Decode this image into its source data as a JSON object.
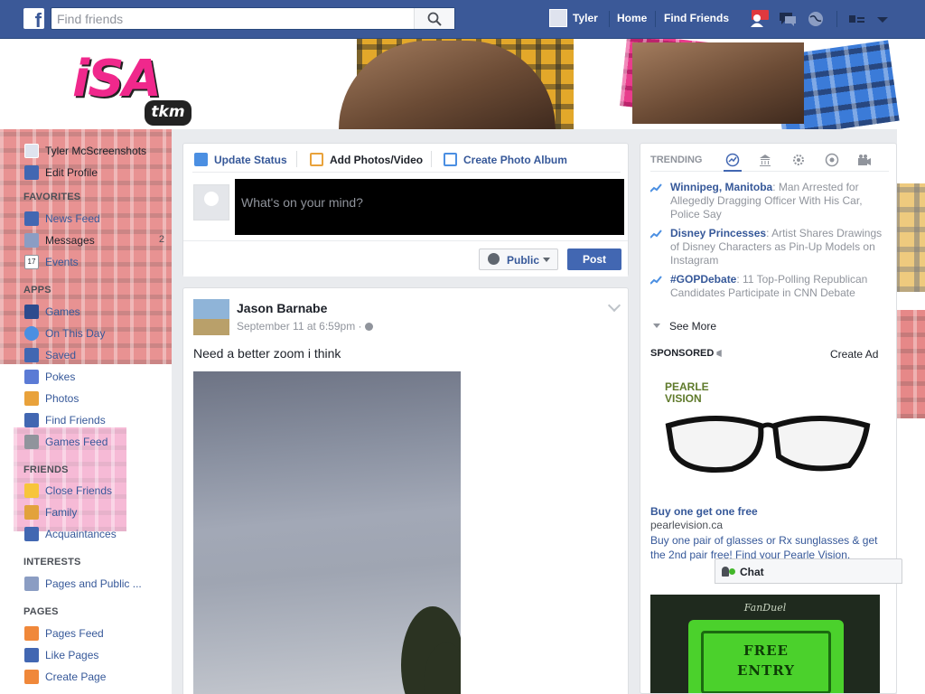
{
  "topbar": {
    "logo": "f",
    "search_placeholder": "Find friends",
    "user_name": "Tyler",
    "home_label": "Home",
    "find_friends_label": "Find Friends",
    "icons": [
      "friend-requests-icon",
      "messages-icon",
      "notifications-icon",
      "privacy-icon",
      "account-menu-icon"
    ]
  },
  "cover": {
    "logo_text": "iSA",
    "logo_sub": "tkm"
  },
  "leftnav": {
    "profile_name": "Tyler McScreenshots",
    "edit_profile": "Edit Profile",
    "favorites_head": "FAVORITES",
    "news_feed": "News Feed",
    "messages": "Messages",
    "messages_count": "2",
    "events": "Events",
    "events_day": "17",
    "apps_head": "APPS",
    "apps": [
      "Games",
      "On This Day",
      "Saved",
      "Pokes",
      "Photos",
      "Find Friends",
      "Games Feed"
    ],
    "friends_head": "FRIENDS",
    "friends": [
      "Close Friends",
      "Family",
      "Acquaintances"
    ],
    "interests_head": "INTERESTS",
    "interests": [
      "Pages and Public ..."
    ],
    "pages_head": "PAGES",
    "pages": [
      "Pages Feed",
      "Like Pages",
      "Create Page"
    ]
  },
  "composer": {
    "tab_status": "Update Status",
    "tab_photo": "Add Photos/Video",
    "tab_album": "Create Photo Album",
    "placeholder": "What's on your mind?",
    "audience": "Public",
    "post_button": "Post"
  },
  "post": {
    "author": "Jason Barnabe",
    "timestamp": "September 11 at 6:59pm",
    "meta_sep": " · ",
    "text": "Need a better zoom i think"
  },
  "trending": {
    "head": "TRENDING",
    "tabs": [
      "trending-icon",
      "politics-icon",
      "science-icon",
      "sports-icon",
      "entertainment-icon"
    ],
    "items": [
      {
        "topic": "Winnipeg, Manitoba",
        "desc": ": Man Arrested for Allegedly Dragging Officer With His Car, Police Say"
      },
      {
        "topic": "Disney Princesses",
        "desc": ": Artist Shares Drawings of Disney Characters as Pin-Up Models on Instagram"
      },
      {
        "topic": "#GOPDebate",
        "desc": ": 11 Top-Polling Republican Candidates Participate in CNN Debate"
      }
    ],
    "see_more": "See More"
  },
  "sponsored": {
    "head": "SPONSORED",
    "create_ad": "Create Ad",
    "ad1_logo_line1": "PEARLE",
    "ad1_logo_line2": "VISION",
    "ad1_title": "Buy one get one free",
    "ad1_url": "pearlevision.ca",
    "ad1_desc": "Buy one pair of glasses or Rx sunglasses & get the 2nd pair free! Find your Pearle Vision.",
    "ad2_brand": "FanDuel",
    "ad2_line1": "FREE",
    "ad2_line2": "ENTRY"
  },
  "chat": {
    "label": "Chat"
  },
  "colors": {
    "topbar": "#3b5998",
    "link": "#365899",
    "post_button": "#4267b2",
    "online": "#42b72a"
  }
}
